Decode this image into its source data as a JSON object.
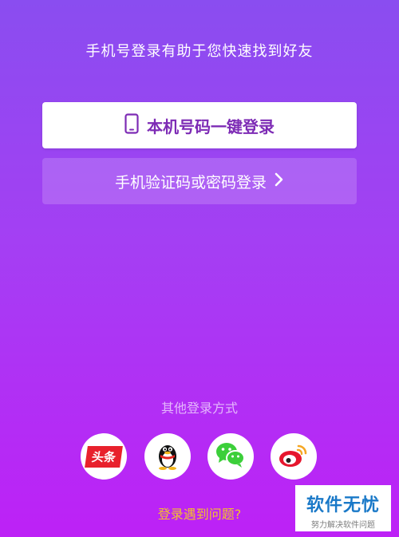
{
  "header": {
    "subtitle": "手机号登录有助于您快速找到好友"
  },
  "login": {
    "one_click_label": "本机号码一键登录",
    "sms_password_label": "手机验证码或密码登录"
  },
  "social": {
    "title": "其他登录方式",
    "items": [
      {
        "name": "toutiao",
        "label": "头条",
        "icon": "toutiao-icon",
        "color": "#e8212c"
      },
      {
        "name": "qq",
        "icon": "qq-penguin-icon",
        "color": "#000000"
      },
      {
        "name": "wechat",
        "icon": "wechat-icon",
        "color": "#3ccf3a"
      },
      {
        "name": "weibo",
        "icon": "weibo-icon",
        "color": "#e6162d"
      }
    ]
  },
  "help": {
    "label": "登录遇到问题?"
  },
  "watermark": {
    "title": "软件无忧",
    "subtitle": "努力解决软件问题"
  },
  "colors": {
    "gradient_top": "#8a4df0",
    "gradient_bottom": "#bd21f6",
    "primary_text": "#7d2bb5",
    "help_link": "#f3c22b"
  }
}
